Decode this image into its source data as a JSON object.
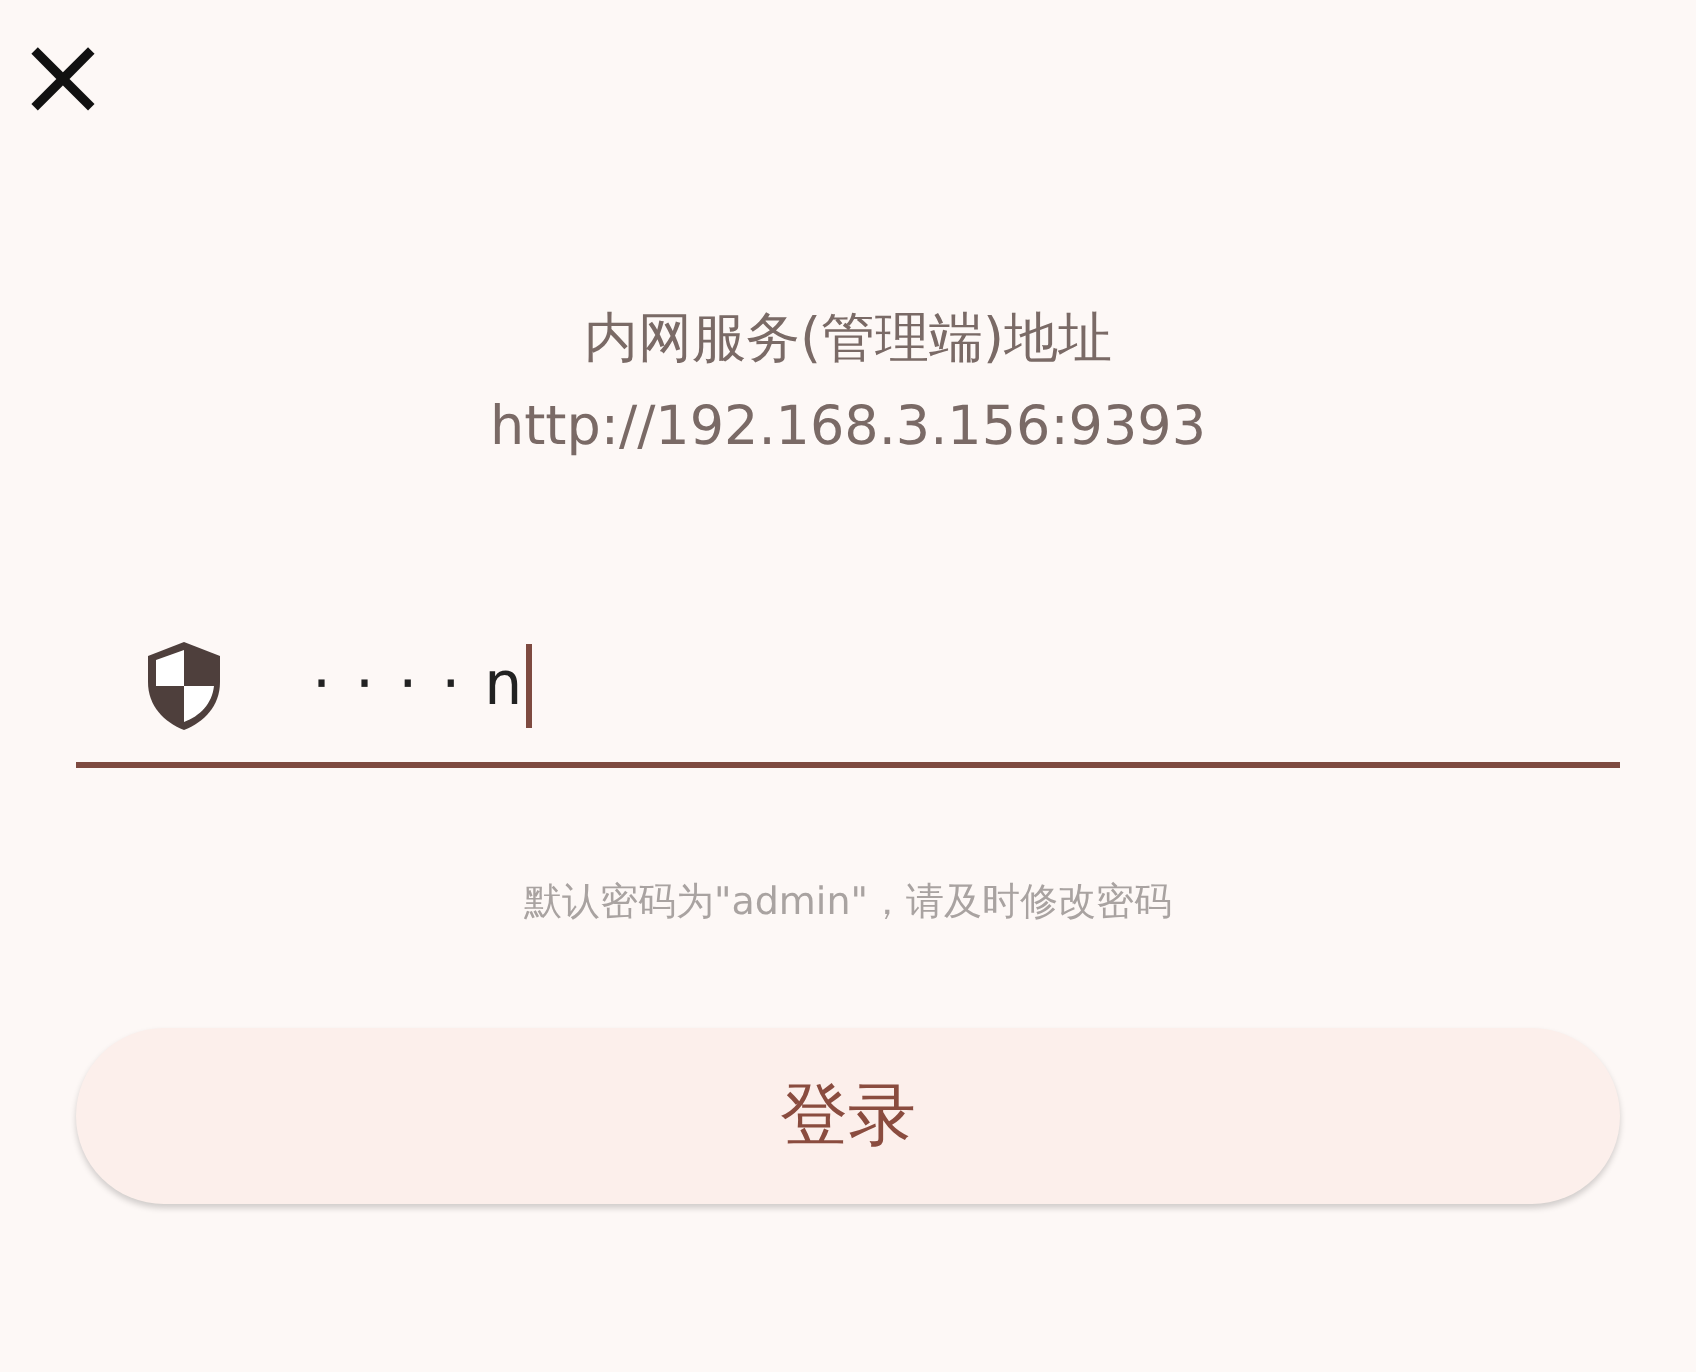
{
  "close_button": {
    "glyph": "×"
  },
  "server": {
    "label": "内网服务(管理端)地址",
    "address": "http://192.168.3.156:9393"
  },
  "password_field": {
    "value": "····n",
    "focused": true
  },
  "hint": "默认密码为\"admin\"，请及时修改密码",
  "login_button": {
    "label": "登录"
  }
}
